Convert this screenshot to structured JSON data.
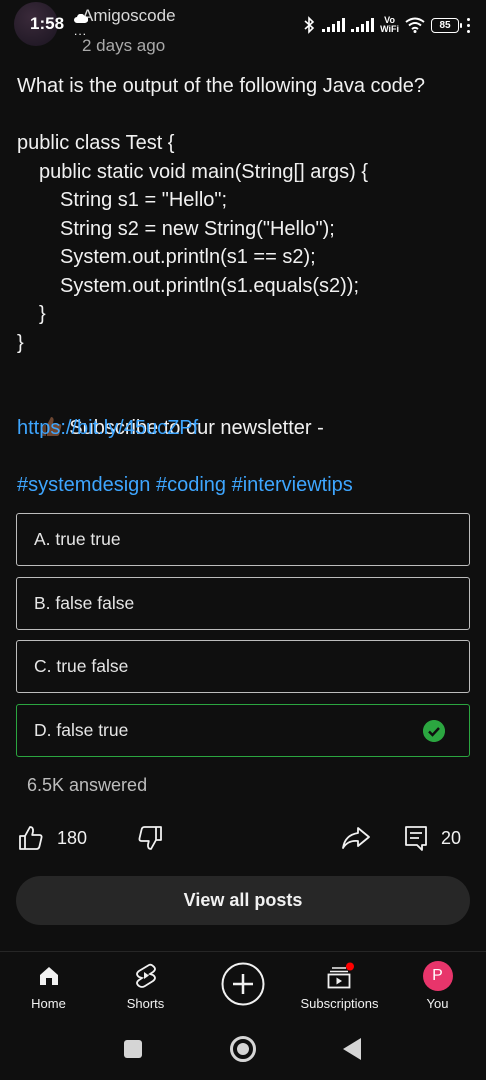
{
  "status_bar": {
    "time": "1:58",
    "more_indicator": "...",
    "battery": "85",
    "vowifi_top": "Vo",
    "vowifi_bottom": "WiFi"
  },
  "post": {
    "channel_name": "Amigoscode",
    "time_ago": "2 days ago",
    "question": "What is the output of the following Java code?",
    "code_lines": [
      "public class Test {",
      "public static void main(String[] args) {",
      "String s1 = \"Hello\";",
      "String s2 = new String(\"Hello\");",
      "System.out.println(s1 == s2);",
      "System.out.println(s1.equals(s2));",
      "}",
      "}"
    ],
    "subscribe_text": "Subscribe to our newsletter -",
    "link": "https://bit.ly/45ucZPf",
    "hashtags": [
      "#systemdesign",
      "#coding",
      "#interviewtips"
    ]
  },
  "quiz": {
    "options": [
      {
        "label": "A. true true",
        "correct": false
      },
      {
        "label": "B. false false",
        "correct": false
      },
      {
        "label": "C. true false",
        "correct": false
      },
      {
        "label": "D. false true",
        "correct": true
      }
    ],
    "answered": "6.5K answered"
  },
  "actions": {
    "likes": "180",
    "comments": "20"
  },
  "view_all_label": "View all posts",
  "bottom_nav": {
    "home": "Home",
    "shorts": "Shorts",
    "subscriptions": "Subscriptions",
    "you": "You",
    "you_initial": "P"
  },
  "colors": {
    "background": "#0f0f0f",
    "link": "#3ea6ff",
    "correct": "#2ba640",
    "avatar": "#e8356b",
    "notification_dot": "#ff0000"
  }
}
